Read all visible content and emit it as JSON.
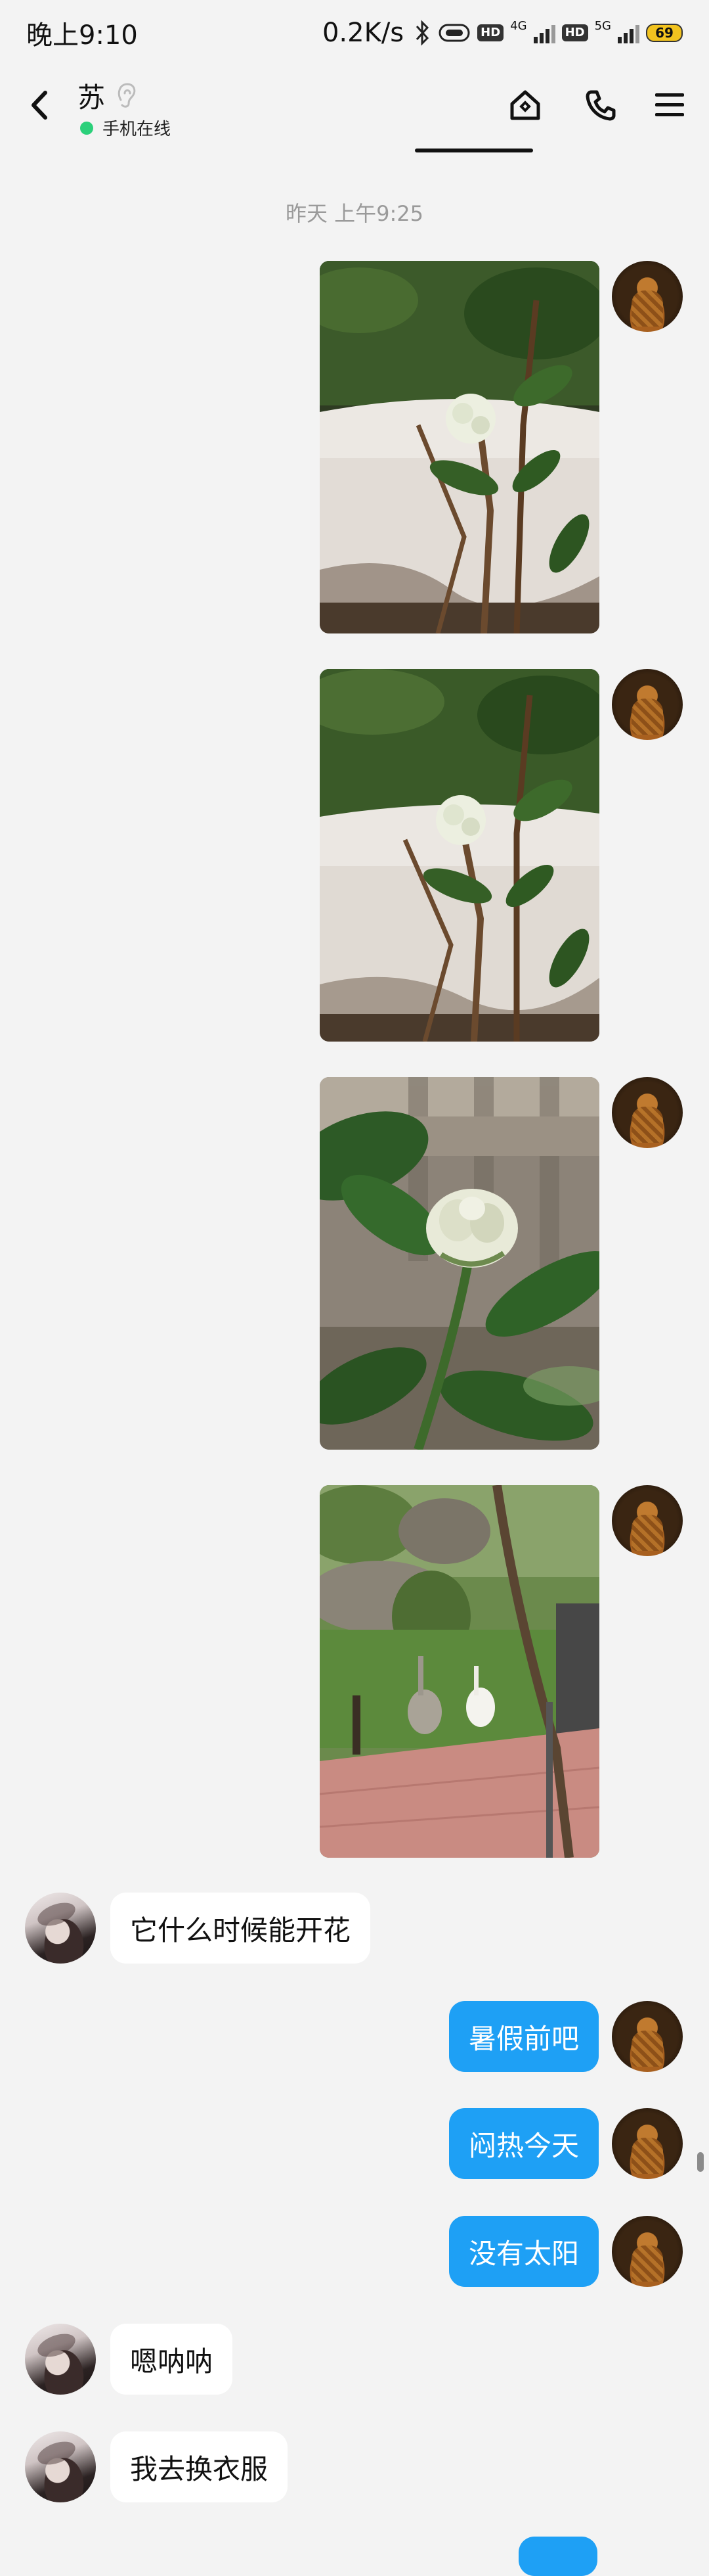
{
  "status_bar": {
    "time": "晚上9:10",
    "net_speed": "0.2K/s",
    "hd1": "HD",
    "net1": "4G",
    "hd2": "HD",
    "net2": "5G",
    "battery": "69"
  },
  "header": {
    "contact_name": "苏",
    "online_status": "手机在线"
  },
  "chat": {
    "timestamp": "昨天 上午9:25",
    "messages": [
      {
        "side": "self",
        "type": "image",
        "desc": "flower-bud-in-pot-1"
      },
      {
        "side": "self",
        "type": "image",
        "desc": "flower-bud-in-pot-2"
      },
      {
        "side": "self",
        "type": "image",
        "desc": "flower-bud-closeup"
      },
      {
        "side": "self",
        "type": "image",
        "desc": "geese-in-park"
      },
      {
        "side": "other",
        "type": "text",
        "text": "它什么时候能开花"
      },
      {
        "side": "self",
        "type": "text",
        "text": "暑假前吧"
      },
      {
        "side": "self",
        "type": "text",
        "text": "闷热今天"
      },
      {
        "side": "self",
        "type": "text",
        "text": "没有太阳"
      },
      {
        "side": "other",
        "type": "text",
        "text": "嗯呐呐"
      },
      {
        "side": "other",
        "type": "text",
        "text": "我去换衣服"
      }
    ]
  },
  "colors": {
    "self_bubble": "#1ea0f5",
    "other_bubble": "#ffffff",
    "online_dot": "#2bd07a",
    "background": "#f3f3f3"
  }
}
